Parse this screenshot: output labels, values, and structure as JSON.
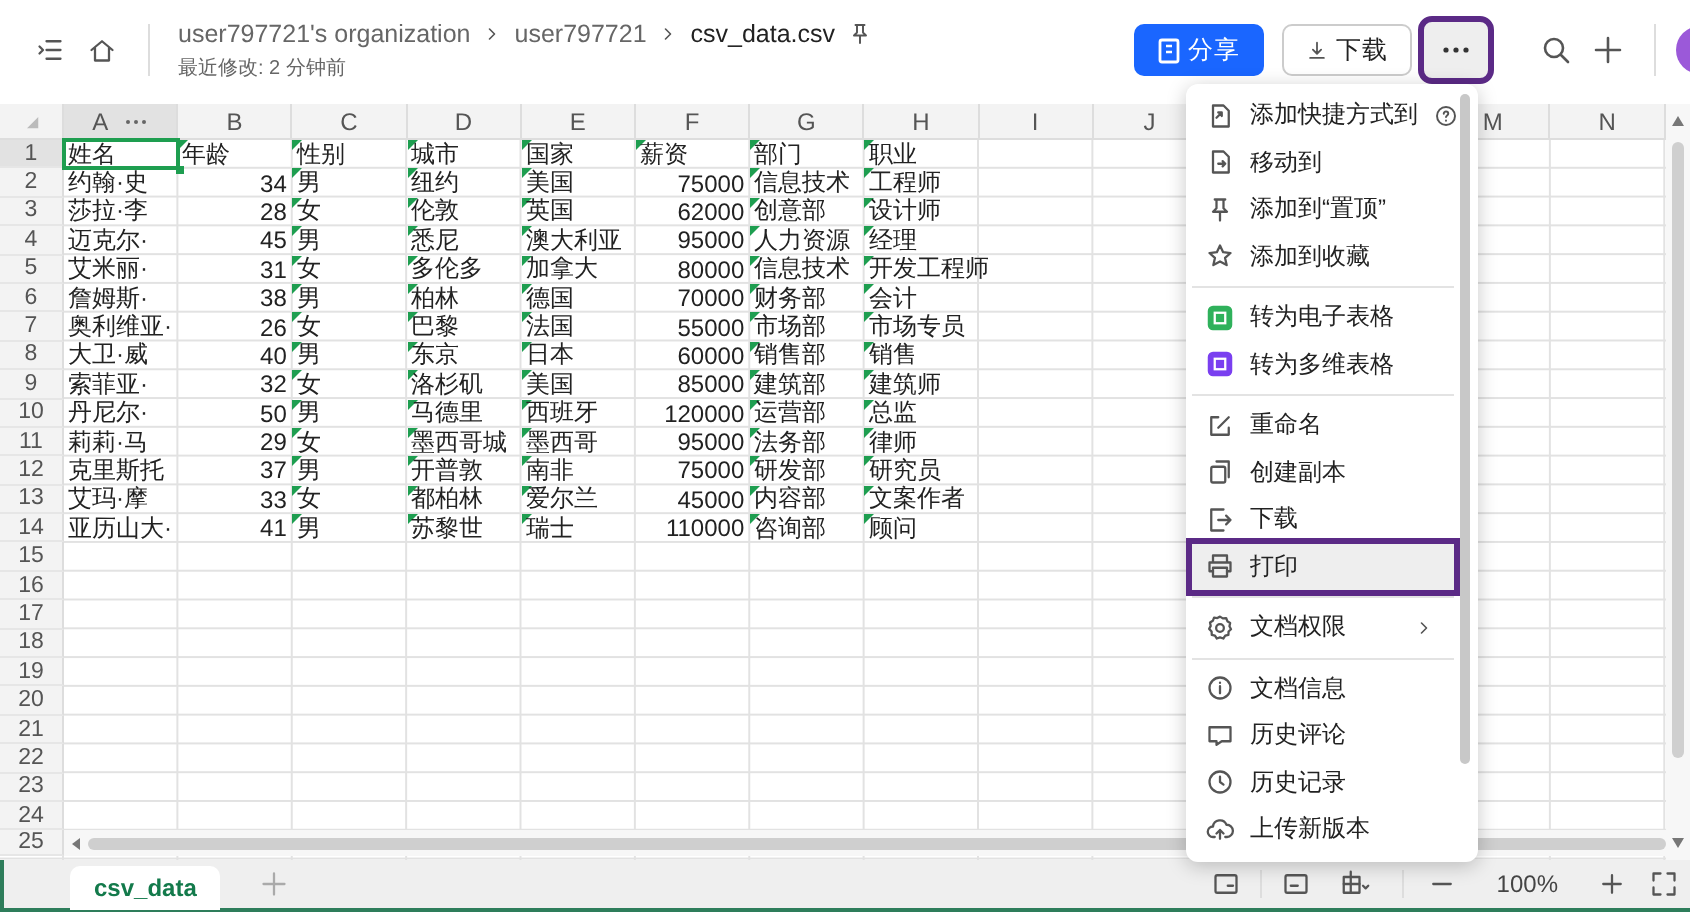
{
  "header": {
    "breadcrumb": [
      "user797721's organization",
      "user797721",
      "csv_data.csv"
    ],
    "subtitle": "最近修改: 2 分钟前",
    "share_button": "分享",
    "download_button": "下载",
    "more_button": {
      "highlighted": true
    }
  },
  "sheet": {
    "columns": [
      "A",
      "B",
      "C",
      "D",
      "E",
      "F",
      "G",
      "H",
      "I",
      "J"
    ],
    "columns_after_menu": [
      "M",
      "N"
    ],
    "row_numbers": [
      "1",
      "2",
      "3",
      "4",
      "5",
      "6",
      "7",
      "8",
      "9",
      "10",
      "11",
      "12",
      "13",
      "14",
      "15",
      "16",
      "17",
      "18",
      "19",
      "20",
      "21",
      "22",
      "23",
      "24",
      "25"
    ],
    "rows": [
      {
        "cells": [
          {
            "text": "姓名",
            "kind": "text",
            "selected": true
          },
          {
            "text": "年龄",
            "kind": "flagged",
            "selected": false
          },
          {
            "text": "性别",
            "kind": "flagged",
            "selected": false
          },
          {
            "text": "城市",
            "kind": "flagged",
            "selected": false
          },
          {
            "text": "国家",
            "kind": "flagged",
            "selected": false
          },
          {
            "text": "薪资",
            "kind": "flagged",
            "selected": false
          },
          {
            "text": "部门",
            "kind": "flagged",
            "selected": false
          },
          {
            "text": "职业",
            "kind": "flagged",
            "selected": false
          }
        ]
      },
      {
        "cells": [
          {
            "text": "约翰·史",
            "kind": "text",
            "selected": false
          },
          {
            "text": "34",
            "kind": "number",
            "selected": false
          },
          {
            "text": "男",
            "kind": "flagged",
            "selected": false
          },
          {
            "text": "纽约",
            "kind": "flagged",
            "selected": false
          },
          {
            "text": "美国",
            "kind": "flagged",
            "selected": false
          },
          {
            "text": "75000",
            "kind": "number",
            "selected": false
          },
          {
            "text": "信息技术",
            "kind": "flagged",
            "selected": false
          },
          {
            "text": "工程师",
            "kind": "flagged",
            "selected": false
          }
        ]
      },
      {
        "cells": [
          {
            "text": "莎拉·李",
            "kind": "text",
            "selected": false
          },
          {
            "text": "28",
            "kind": "number",
            "selected": false
          },
          {
            "text": "女",
            "kind": "flagged",
            "selected": false
          },
          {
            "text": "伦敦",
            "kind": "flagged",
            "selected": false
          },
          {
            "text": "英国",
            "kind": "flagged",
            "selected": false
          },
          {
            "text": "62000",
            "kind": "number",
            "selected": false
          },
          {
            "text": "创意部",
            "kind": "flagged",
            "selected": false
          },
          {
            "text": "设计师",
            "kind": "flagged",
            "selected": false
          }
        ]
      },
      {
        "cells": [
          {
            "text": "迈克尔·",
            "kind": "text",
            "selected": false
          },
          {
            "text": "45",
            "kind": "number",
            "selected": false
          },
          {
            "text": "男",
            "kind": "flagged",
            "selected": false
          },
          {
            "text": "悉尼",
            "kind": "flagged",
            "selected": false
          },
          {
            "text": "澳大利亚",
            "kind": "flagged",
            "selected": false
          },
          {
            "text": "95000",
            "kind": "number",
            "selected": false
          },
          {
            "text": "人力资源",
            "kind": "flagged",
            "selected": false
          },
          {
            "text": "经理",
            "kind": "flagged",
            "selected": false
          }
        ]
      },
      {
        "cells": [
          {
            "text": "艾米丽·",
            "kind": "text",
            "selected": false
          },
          {
            "text": "31",
            "kind": "number",
            "selected": false
          },
          {
            "text": "女",
            "kind": "flagged",
            "selected": false
          },
          {
            "text": "多伦多",
            "kind": "flagged",
            "selected": false
          },
          {
            "text": "加拿大",
            "kind": "flagged",
            "selected": false
          },
          {
            "text": "80000",
            "kind": "number",
            "selected": false
          },
          {
            "text": "信息技术",
            "kind": "flagged",
            "selected": false
          },
          {
            "text": "开发工程师",
            "kind": "flagged",
            "selected": false
          }
        ]
      },
      {
        "cells": [
          {
            "text": "詹姆斯·",
            "kind": "text",
            "selected": false
          },
          {
            "text": "38",
            "kind": "number",
            "selected": false
          },
          {
            "text": "男",
            "kind": "flagged",
            "selected": false
          },
          {
            "text": "柏林",
            "kind": "flagged",
            "selected": false
          },
          {
            "text": "德国",
            "kind": "flagged",
            "selected": false
          },
          {
            "text": "70000",
            "kind": "number",
            "selected": false
          },
          {
            "text": "财务部",
            "kind": "flagged",
            "selected": false
          },
          {
            "text": "会计",
            "kind": "flagged",
            "selected": false
          }
        ]
      },
      {
        "cells": [
          {
            "text": "奥利维亚·",
            "kind": "text",
            "selected": false
          },
          {
            "text": "26",
            "kind": "number",
            "selected": false
          },
          {
            "text": "女",
            "kind": "flagged",
            "selected": false
          },
          {
            "text": "巴黎",
            "kind": "flagged",
            "selected": false
          },
          {
            "text": "法国",
            "kind": "flagged",
            "selected": false
          },
          {
            "text": "55000",
            "kind": "number",
            "selected": false
          },
          {
            "text": "市场部",
            "kind": "flagged",
            "selected": false
          },
          {
            "text": "市场专员",
            "kind": "flagged",
            "selected": false
          }
        ]
      },
      {
        "cells": [
          {
            "text": "大卫·威",
            "kind": "text",
            "selected": false
          },
          {
            "text": "40",
            "kind": "number",
            "selected": false
          },
          {
            "text": "男",
            "kind": "flagged",
            "selected": false
          },
          {
            "text": "东京",
            "kind": "flagged",
            "selected": false
          },
          {
            "text": "日本",
            "kind": "flagged",
            "selected": false
          },
          {
            "text": "60000",
            "kind": "number",
            "selected": false
          },
          {
            "text": "销售部",
            "kind": "flagged",
            "selected": false
          },
          {
            "text": "销售",
            "kind": "flagged",
            "selected": false
          }
        ]
      },
      {
        "cells": [
          {
            "text": "索菲亚·",
            "kind": "text",
            "selected": false
          },
          {
            "text": "32",
            "kind": "number",
            "selected": false
          },
          {
            "text": "女",
            "kind": "flagged",
            "selected": false
          },
          {
            "text": "洛杉矶",
            "kind": "flagged",
            "selected": false
          },
          {
            "text": "美国",
            "kind": "flagged",
            "selected": false
          },
          {
            "text": "85000",
            "kind": "number",
            "selected": false
          },
          {
            "text": "建筑部",
            "kind": "flagged",
            "selected": false
          },
          {
            "text": "建筑师",
            "kind": "flagged",
            "selected": false
          }
        ]
      },
      {
        "cells": [
          {
            "text": "丹尼尔·",
            "kind": "text",
            "selected": false
          },
          {
            "text": "50",
            "kind": "number",
            "selected": false
          },
          {
            "text": "男",
            "kind": "flagged",
            "selected": false
          },
          {
            "text": "马德里",
            "kind": "flagged",
            "selected": false
          },
          {
            "text": "西班牙",
            "kind": "flagged",
            "selected": false
          },
          {
            "text": "120000",
            "kind": "number",
            "selected": false
          },
          {
            "text": "运营部",
            "kind": "flagged",
            "selected": false
          },
          {
            "text": "总监",
            "kind": "flagged",
            "selected": false
          }
        ]
      },
      {
        "cells": [
          {
            "text": "莉莉·马",
            "kind": "text",
            "selected": false
          },
          {
            "text": "29",
            "kind": "number",
            "selected": false
          },
          {
            "text": "女",
            "kind": "flagged",
            "selected": false
          },
          {
            "text": "墨西哥城",
            "kind": "flagged",
            "selected": false
          },
          {
            "text": "墨西哥",
            "kind": "flagged",
            "selected": false
          },
          {
            "text": "95000",
            "kind": "number",
            "selected": false
          },
          {
            "text": "法务部",
            "kind": "flagged",
            "selected": false
          },
          {
            "text": "律师",
            "kind": "flagged",
            "selected": false
          }
        ]
      },
      {
        "cells": [
          {
            "text": "克里斯托",
            "kind": "text",
            "selected": false
          },
          {
            "text": "37",
            "kind": "number",
            "selected": false
          },
          {
            "text": "男",
            "kind": "flagged",
            "selected": false
          },
          {
            "text": "开普敦",
            "kind": "flagged",
            "selected": false
          },
          {
            "text": "南非",
            "kind": "flagged",
            "selected": false
          },
          {
            "text": "75000",
            "kind": "number",
            "selected": false
          },
          {
            "text": "研发部",
            "kind": "flagged",
            "selected": false
          },
          {
            "text": "研究员",
            "kind": "flagged",
            "selected": false
          }
        ]
      },
      {
        "cells": [
          {
            "text": "艾玛·摩",
            "kind": "text",
            "selected": false
          },
          {
            "text": "33",
            "kind": "number",
            "selected": false
          },
          {
            "text": "女",
            "kind": "flagged",
            "selected": false
          },
          {
            "text": "都柏林",
            "kind": "flagged",
            "selected": false
          },
          {
            "text": "爱尔兰",
            "kind": "flagged",
            "selected": false
          },
          {
            "text": "45000",
            "kind": "number",
            "selected": false
          },
          {
            "text": "内容部",
            "kind": "flagged",
            "selected": false
          },
          {
            "text": "文案作者",
            "kind": "flagged",
            "selected": false
          }
        ]
      },
      {
        "cells": [
          {
            "text": "亚历山大·",
            "kind": "text",
            "selected": false
          },
          {
            "text": "41",
            "kind": "number",
            "selected": false
          },
          {
            "text": "男",
            "kind": "flagged",
            "selected": false
          },
          {
            "text": "苏黎世",
            "kind": "flagged",
            "selected": false
          },
          {
            "text": "瑞士",
            "kind": "flagged",
            "selected": false
          },
          {
            "text": "110000",
            "kind": "number",
            "selected": false
          },
          {
            "text": "咨询部",
            "kind": "flagged",
            "selected": false
          },
          {
            "text": "顾问",
            "kind": "flagged",
            "selected": false
          }
        ]
      }
    ]
  },
  "sheet_tabs": [
    {
      "label": "csv_data",
      "selected": true
    }
  ],
  "zoom": "100%",
  "menu": {
    "groups": [
      [
        {
          "label": "添加快捷方式到",
          "kind": "help",
          "highlighted": false
        },
        {
          "label": "移动到",
          "kind": "plain",
          "highlighted": false
        },
        {
          "label": "添加到“置顶”",
          "kind": "plain",
          "highlighted": false
        },
        {
          "label": "添加到收藏",
          "kind": "plain",
          "highlighted": false
        }
      ],
      [
        {
          "label": "转为电子表格",
          "kind": "plain",
          "highlighted": false
        },
        {
          "label": "转为多维表格",
          "kind": "plain",
          "highlighted": false
        }
      ],
      [
        {
          "label": "重命名",
          "kind": "plain",
          "highlighted": false
        },
        {
          "label": "创建副本",
          "kind": "plain",
          "highlighted": false
        },
        {
          "label": "下载",
          "kind": "plain",
          "highlighted": false
        },
        {
          "label": "打印",
          "kind": "plain",
          "highlighted": true
        }
      ],
      [
        {
          "label": "文档权限",
          "kind": "submenu",
          "highlighted": false
        }
      ],
      [
        {
          "label": "文档信息",
          "kind": "plain",
          "highlighted": false
        },
        {
          "label": "历史评论",
          "kind": "plain",
          "highlighted": false
        },
        {
          "label": "历史记录",
          "kind": "plain",
          "highlighted": false
        },
        {
          "label": "上传新版本",
          "kind": "plain",
          "highlighted": false
        }
      ]
    ]
  }
}
